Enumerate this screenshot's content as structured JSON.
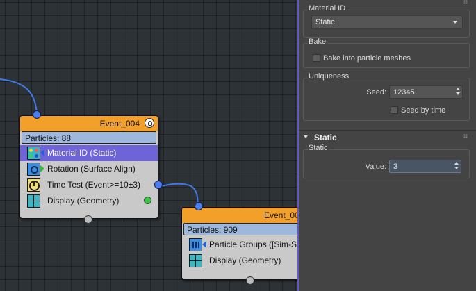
{
  "graph": {
    "node1": {
      "title": "Event_004",
      "particles": "Particles: 88",
      "operators": [
        {
          "label": "Material ID (Static)",
          "icon": "material-id-icon",
          "selected": true
        },
        {
          "label": "Rotation (Surface Align)",
          "icon": "rotation-icon",
          "selected": false
        },
        {
          "label": "Time Test (Event>=10±3)",
          "icon": "clock-icon",
          "selected": false
        },
        {
          "label": "Display (Geometry)",
          "icon": "display-icon",
          "selected": false
        }
      ]
    },
    "node2": {
      "title": "Event_00",
      "particles": "Particles: 909",
      "operators": [
        {
          "label": "Particle Groups ([Sim-Se",
          "icon": "particle-groups-icon",
          "selected": false
        },
        {
          "label": "Display (Geometry)",
          "icon": "display-icon",
          "selected": false
        }
      ]
    },
    "colors": {
      "header": "#f2a02a",
      "selected_row": "#6f63d8",
      "particles_bar": "#9db8dc",
      "wire": "#3f7ae8"
    }
  },
  "panel": {
    "material_id": {
      "title": "Material ID",
      "dropdown_value": "Static"
    },
    "bake": {
      "title": "Bake",
      "checkbox_label": "Bake into particle meshes",
      "checked": false
    },
    "uniqueness": {
      "title": "Uniqueness",
      "seed_label": "Seed:",
      "seed_value": "12345",
      "seed_by_time_label": "Seed by time",
      "seed_by_time_checked": false
    },
    "static_rollout": {
      "title": "Static",
      "group_title": "Static",
      "value_label": "Value:",
      "value": "3"
    },
    "accent": "#5f58c8"
  }
}
